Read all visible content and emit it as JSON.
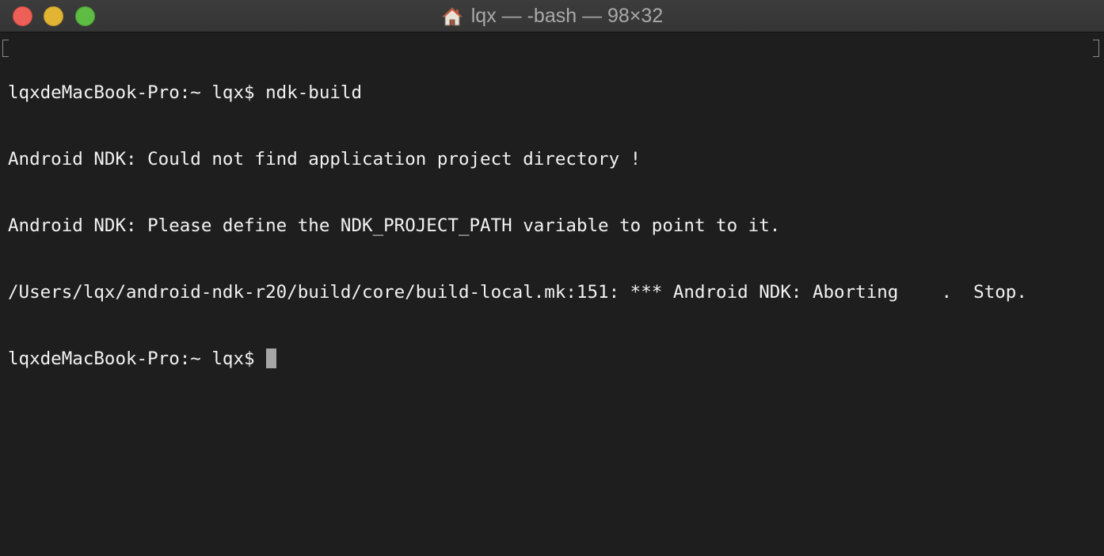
{
  "window": {
    "title": "lqx — -bash — 98×32",
    "title_icon": "home-icon"
  },
  "terminal": {
    "lines": [
      "lqxdeMacBook-Pro:~ lqx$ ndk-build",
      "Android NDK: Could not find application project directory !",
      "Android NDK: Please define the NDK_PROJECT_PATH variable to point to it.",
      "/Users/lqx/android-ndk-r20/build/core/build-local.mk:151: *** Android NDK: Aborting    .  Stop."
    ],
    "prompt": "lqxdeMacBook-Pro:~ lqx$",
    "cursor_color": "#a6a6a6",
    "background_color": "#1e1e1e",
    "text_color": "#f2f2f2"
  },
  "colors": {
    "close": "#ed5f57",
    "minimize": "#e1b434",
    "zoom": "#5ebb43"
  }
}
